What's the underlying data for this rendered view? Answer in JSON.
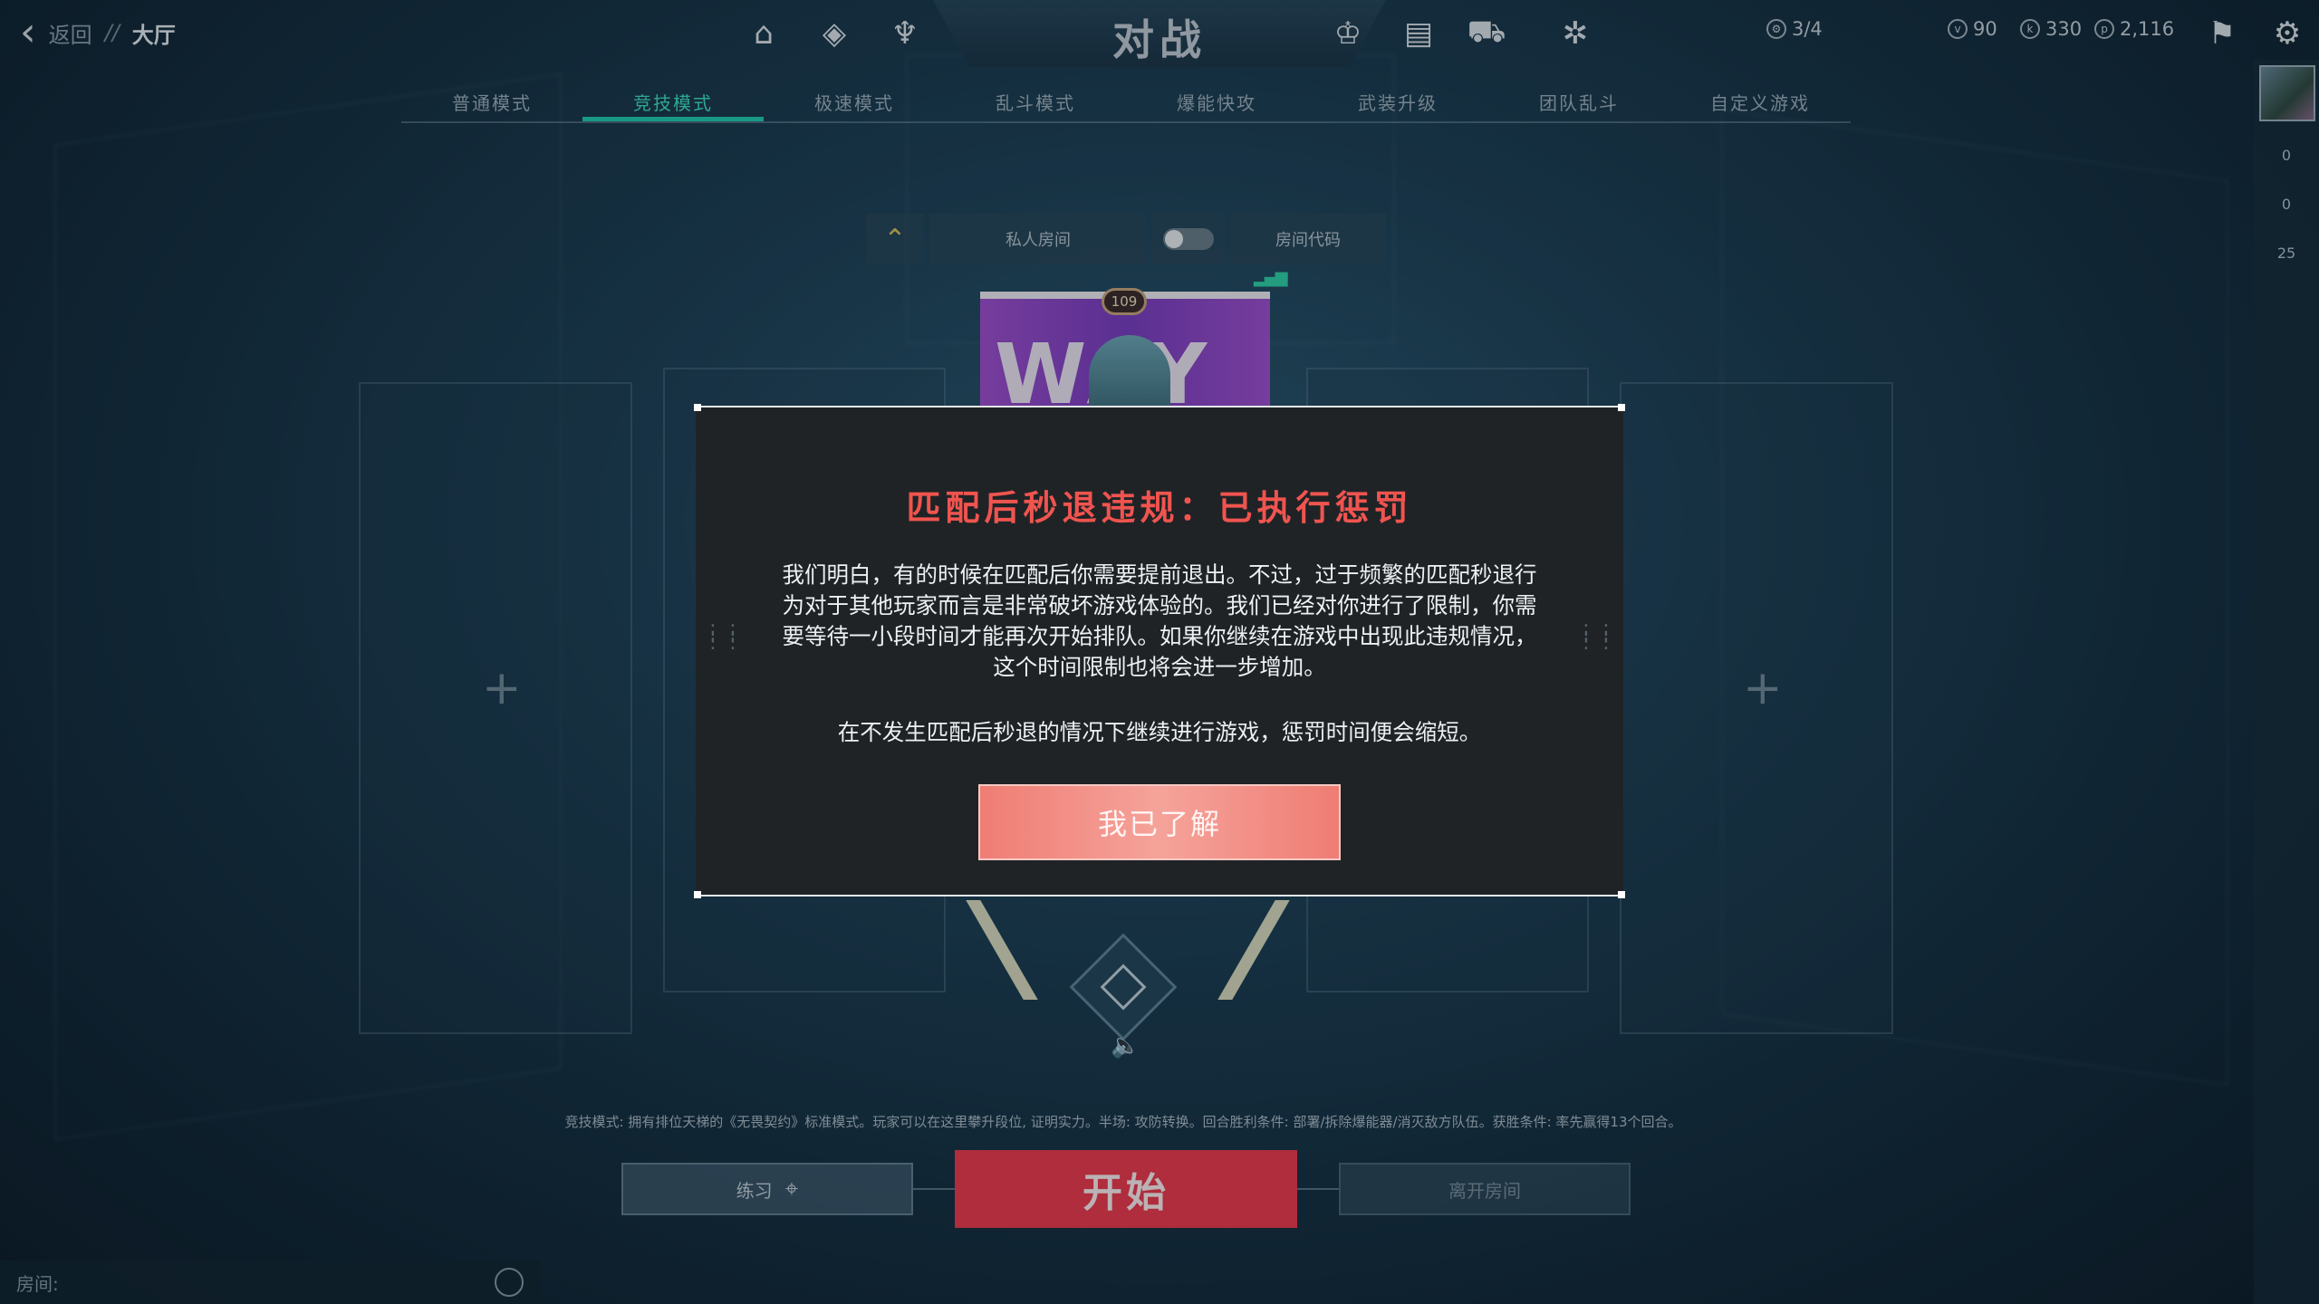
{
  "topbar": {
    "back_label": "返回",
    "crumb_sep": "//",
    "crumb_current": "大厅",
    "title": "对战",
    "left_icons": [
      "home-icon",
      "agents-icon",
      "career-icon"
    ],
    "right_icons": [
      "trophy-icon",
      "collection-icon",
      "store-icon",
      "battlepass-icon"
    ],
    "party_count": "3/4",
    "currencies": [
      {
        "name": "radianite",
        "value": "90"
      },
      {
        "name": "kingdom-credits",
        "value": "330"
      },
      {
        "name": "valorant-points",
        "value": "2,116"
      }
    ]
  },
  "tabs": [
    {
      "label": "普通模式",
      "active": false
    },
    {
      "label": "竞技模式",
      "active": true
    },
    {
      "label": "极速模式",
      "active": false
    },
    {
      "label": "乱斗模式",
      "active": false
    },
    {
      "label": "爆能快攻",
      "active": false
    },
    {
      "label": "武装升级",
      "active": false
    },
    {
      "label": "团队乱斗",
      "active": false
    },
    {
      "label": "自定义游戏",
      "active": false
    }
  ],
  "room": {
    "private_label": "私人房间",
    "code_label": "房间代码"
  },
  "player_card": {
    "level": "109",
    "banner_text": "WAY"
  },
  "rail": {
    "counts": [
      "0",
      "0",
      "25"
    ]
  },
  "mode_description": "竞技模式: 拥有排位天梯的《无畏契约》标准模式。玩家可以在这里攀升段位, 证明实力。半场: 攻防转换。回合胜利条件: 部署/拆除爆能器/消灭敌方队伍。获胜条件: 率先赢得13个回合。",
  "buttons": {
    "practice": "练习",
    "start": "开始",
    "leave": "离开房间"
  },
  "chat": {
    "label": "房间:"
  },
  "modal": {
    "title": "匹配后秒退违规：已执行惩罚",
    "body": "我们明白，有的时候在匹配后你需要提前退出。不过，过于频繁的匹配秒退行为对于其他玩家而言是非常破坏游戏体验的。我们已经对你进行了限制，你需要等待一小段时间才能再次开始排队。如果你继续在游戏中出现此违规情况，这个时间限制也将会进一步增加。",
    "note": "在不发生匹配后秒退的情况下继续进行游戏，惩罚时间便会缩短。",
    "confirm": "我已了解"
  },
  "colors": {
    "accent_tab": "#1fcfb0",
    "start_button": "#f0394d",
    "modal_title": "#f0544f",
    "modal_button": "#ef7d74"
  }
}
